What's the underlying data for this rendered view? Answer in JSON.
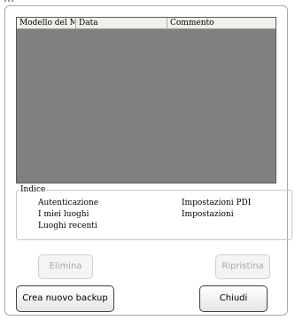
{
  "list": {
    "columns": [
      "Modello del Mio",
      "Data",
      "Commento"
    ]
  },
  "indice": {
    "title": "Indice",
    "links": [
      "Autenticazione",
      "I miei luoghi",
      "Luoghi recenti",
      "Impostazioni PDI",
      "Impostazioni"
    ]
  },
  "buttons": {
    "delete": "Elimina",
    "restore": "Ripristina",
    "create_backup": "Crea nuovo backup",
    "close": "Chiudi"
  },
  "colors": {
    "list_background": "#808080",
    "header_background": "#f0f0e8"
  }
}
